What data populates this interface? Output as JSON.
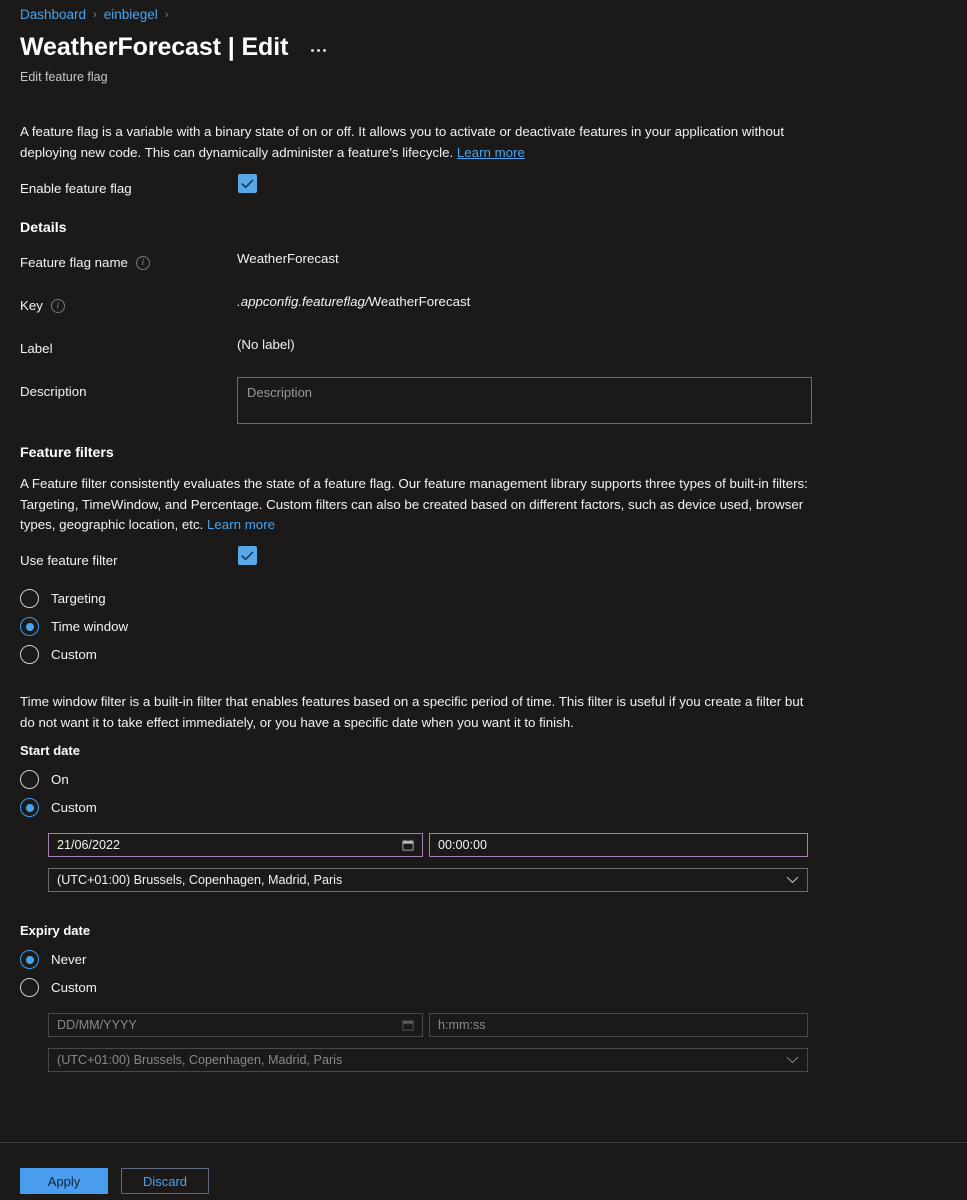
{
  "breadcrumb": {
    "items": [
      {
        "label": "Dashboard"
      },
      {
        "label": "einbiegel"
      }
    ],
    "separator": "›"
  },
  "header": {
    "title": "WeatherForecast | Edit",
    "subtitle": "Edit feature flag",
    "more_menu": "more-options"
  },
  "intro": {
    "text_before_link": "A feature flag is a variable with a binary state of on or off. It allows you to activate or deactivate features in your application without deploying new code. This can dynamically administer a feature's lifecycle. ",
    "link_label": "Learn more"
  },
  "enable_flag": {
    "label": "Enable feature flag",
    "checked": true
  },
  "details": {
    "heading": "Details",
    "rows": [
      {
        "label": "Feature flag name",
        "info": true,
        "value": "WeatherForecast"
      },
      {
        "label": "Key",
        "info": true,
        "value_italic": ".appconfig.featureflag/",
        "value": "WeatherForecast"
      },
      {
        "label": "Label",
        "info": false,
        "value": "(No label)"
      }
    ],
    "description": {
      "label": "Description",
      "value": "",
      "placeholder": "Description"
    }
  },
  "feature_filters": {
    "heading": "Feature filters",
    "text_before_link": "A Feature filter consistently evaluates the state of a feature flag. Our feature management library supports three types of built-in filters: Targeting, TimeWindow, and Percentage. Custom filters can also be created based on different factors, such as device used, browser types, geographic location, etc. ",
    "link_label": "Learn more",
    "use_filter": {
      "label": "Use feature filter",
      "checked": true
    },
    "filter_types": [
      {
        "label": "Targeting",
        "selected": false
      },
      {
        "label": "Time window",
        "selected": true
      },
      {
        "label": "Custom",
        "selected": false
      }
    ]
  },
  "time_window": {
    "description": "Time window filter is a built-in filter that enables features based on a specific period of time. This filter is useful if you create a filter but do not want it to take effect immediately, or you have a specific date when you want it to finish.",
    "start_date": {
      "heading": "Start date",
      "options": [
        {
          "label": "On",
          "selected": false
        },
        {
          "label": "Custom",
          "selected": true
        }
      ],
      "date_value": "21/06/2022",
      "date_placeholder": "DD/MM/YYYY",
      "time_value": "00:00:00",
      "time_placeholder": "h:mm:ss",
      "timezone": "(UTC+01:00) Brussels, Copenhagen, Madrid, Paris",
      "enabled": true
    },
    "expiry_date": {
      "heading": "Expiry date",
      "options": [
        {
          "label": "Never",
          "selected": true
        },
        {
          "label": "Custom",
          "selected": false
        }
      ],
      "date_value": "",
      "date_placeholder": "DD/MM/YYYY",
      "time_value": "",
      "time_placeholder": "h:mm:ss",
      "timezone": "(UTC+01:00) Brussels, Copenhagen, Madrid, Paris",
      "enabled": false
    }
  },
  "footer": {
    "apply_label": "Apply",
    "discard_label": "Discard"
  },
  "colors": {
    "background": "#1b1a19",
    "link": "#4aa3ec",
    "accent_checkbox": "#59a9e6",
    "accent_radio": "#4aa3ec",
    "input_active_border": "#a67fbb",
    "input_border": "#6e6c6a",
    "primary_button": "#4a9cef"
  }
}
